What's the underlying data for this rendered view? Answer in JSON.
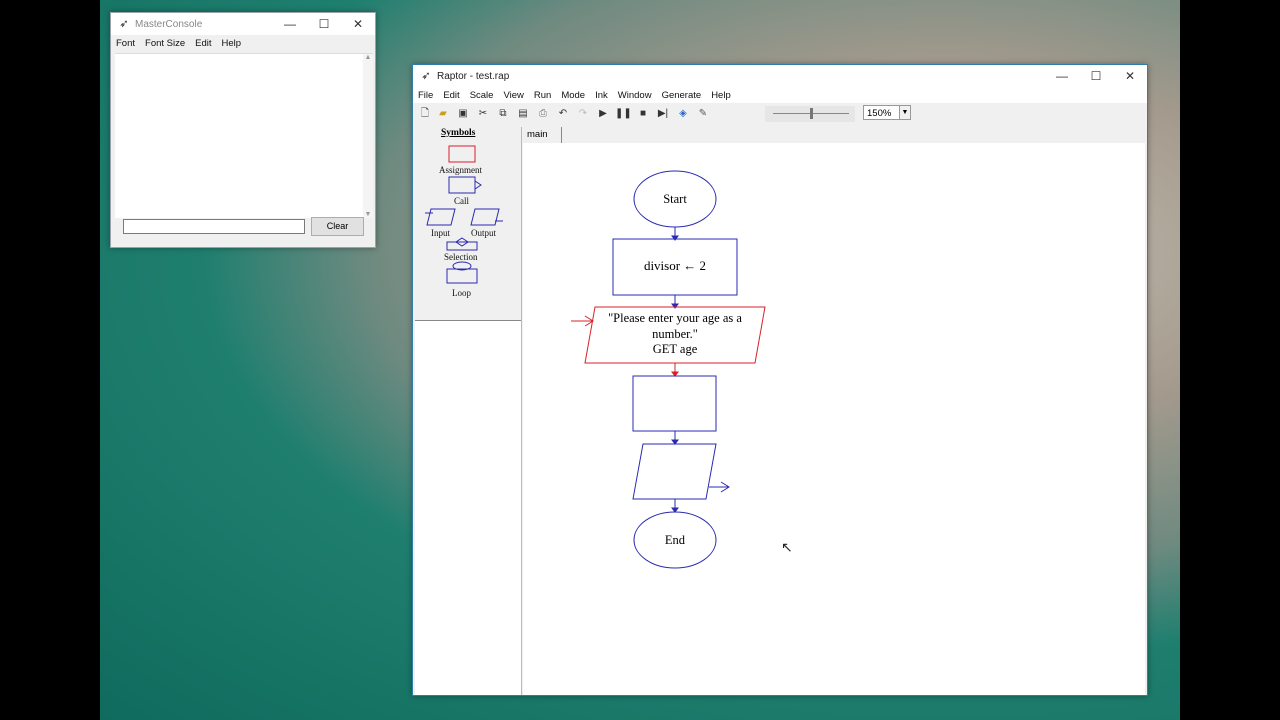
{
  "master_console": {
    "title": "MasterConsole",
    "menu": [
      "Font",
      "Font Size",
      "Edit",
      "Help"
    ],
    "clear_label": "Clear",
    "input_value": ""
  },
  "raptor": {
    "title": "Raptor - test.rap",
    "menu": [
      "File",
      "Edit",
      "Scale",
      "View",
      "Run",
      "Mode",
      "Ink",
      "Window",
      "Generate",
      "Help"
    ],
    "zoom": "150%",
    "symbols_heading": "Symbols",
    "symbols": {
      "assignment": "Assignment",
      "call": "Call",
      "input": "Input",
      "output": "Output",
      "selection": "Selection",
      "loop": "Loop"
    },
    "tab": "main",
    "flow": {
      "start": "Start",
      "assign": "divisor ← 2",
      "input_line1": "\"Please enter your age as a",
      "input_line2": "number.\"",
      "input_line3": "GET age",
      "end": "End"
    }
  },
  "colors": {
    "flow_stroke": "#2a2ab0",
    "selected_stroke": "#d8202a"
  }
}
